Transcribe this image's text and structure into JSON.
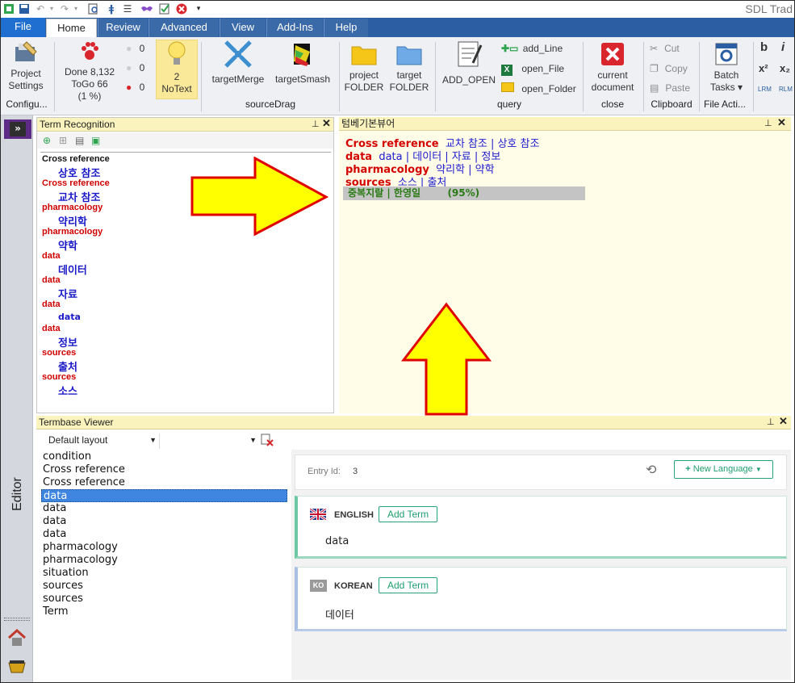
{
  "window": {
    "title": "SDL Trad"
  },
  "menu": {
    "tabs": [
      {
        "label": "File"
      },
      {
        "label": "Home"
      },
      {
        "label": "Review"
      },
      {
        "label": "Advanced"
      },
      {
        "label": "View"
      },
      {
        "label": "Add-Ins"
      },
      {
        "label": "Help"
      }
    ]
  },
  "ribbon": {
    "project_settings": {
      "line1": "Project",
      "line2": "Settings"
    },
    "configure_group": "Configu...",
    "status": {
      "done": "Done 8,132",
      "togo": "ToGo 66",
      "pct": "(1 %)"
    },
    "counters": [
      "0",
      "0",
      "0"
    ],
    "notext": {
      "line1": "2",
      "line2": "NoText"
    },
    "target_merge": "targetMerge",
    "target_smash": "targetSmash",
    "source_drag_group": "sourceDrag",
    "project_folder": {
      "line1": "project",
      "line2": "FOLDER"
    },
    "target_folder": {
      "line1": "target",
      "line2": "FOLDER"
    },
    "add_open": "ADD_OPEN",
    "add_line": "add_Line",
    "open_file": "open_File",
    "open_folder": "open_Folder",
    "query_group": "query",
    "current_document": {
      "line1": "current",
      "line2": "document"
    },
    "close_group": "close",
    "clipboard": {
      "cut": "Cut",
      "copy": "Copy",
      "paste": "Paste",
      "group": "Clipboard"
    },
    "batch_tasks": {
      "line1": "Batch",
      "line2": "Tasks ▾"
    },
    "file_actions_group": "File Acti...",
    "format": {
      "bold": "b",
      "italic": "i",
      "sup": "x²",
      "sub": "x₂",
      "lrm": "LRM",
      "rlm": "RLM"
    }
  },
  "sidebar": {
    "label": "Editor",
    "toggle": "»"
  },
  "term_recognition": {
    "title": "Term Recognition",
    "entries": [
      {
        "source": "Cross reference",
        "target": "상호 참조"
      },
      {
        "source": "Cross reference",
        "target": "교차 참조"
      },
      {
        "source": "pharmacology",
        "target": "약리학"
      },
      {
        "source": "pharmacology",
        "target": "약학"
      },
      {
        "source": "data",
        "target": "데이터"
      },
      {
        "source": "data",
        "target": "자료"
      },
      {
        "source": "data",
        "target": "data"
      },
      {
        "source": "data",
        "target": "정보"
      },
      {
        "source": "sources",
        "target": "출처"
      },
      {
        "source": "sources",
        "target": "소스"
      }
    ]
  },
  "termbase_preview": {
    "title": "텀베기본뷰어",
    "lines": [
      {
        "source": "Cross reference",
        "targets": "교차 참조 | 상호 참조"
      },
      {
        "source": "data",
        "targets": "data | 데이터 | 자료 | 정보"
      },
      {
        "source": "pharmacology",
        "targets": "약리학 | 약학"
      },
      {
        "source": "sources",
        "targets": "소스 | 출처"
      }
    ],
    "highlight": "중복지랄 | 한영일        (95%)"
  },
  "termbase_viewer": {
    "title": "Termbase Viewer",
    "layout": "Default layout",
    "list": [
      "condition",
      "Cross reference",
      "Cross reference",
      "data",
      "data",
      "data",
      "data",
      "pharmacology",
      "pharmacology",
      "situation",
      "sources",
      "sources",
      "Term"
    ],
    "selected_index": 3,
    "entry_label": "Entry Id:",
    "entry_id": "3",
    "new_language": "New Language",
    "languages": [
      {
        "name": "ENGLISH",
        "add": "Add Term",
        "term": "data",
        "badge": ""
      },
      {
        "name": "KOREAN",
        "add": "Add Term",
        "term": "데이터",
        "badge": "KO"
      }
    ]
  },
  "colors": {
    "menubar": "#2c5ea3",
    "file_tab": "#1f6fd1",
    "panel_header": "#fbf3bd",
    "source_term": "#d40000",
    "target_term": "#1a1ad0",
    "arrow_fill": "#ffff00",
    "arrow_stroke": "#e00000"
  }
}
